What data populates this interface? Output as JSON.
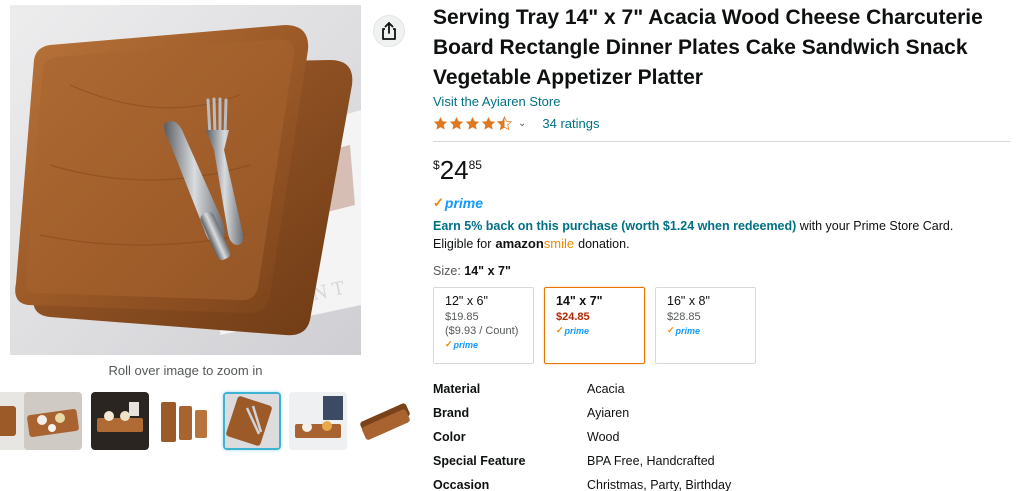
{
  "gallery": {
    "zoom_hint": "Roll over image to zoom in",
    "share_icon": "share-icon",
    "main_image_text": "PRINT",
    "thumbnails": [
      {
        "name": "thumb-tray-side"
      },
      {
        "name": "thumb-food-table"
      },
      {
        "name": "thumb-hand-dessert"
      },
      {
        "name": "thumb-three-trays"
      },
      {
        "name": "thumb-tray-utensils"
      },
      {
        "name": "thumb-hands-tray"
      },
      {
        "name": "thumb-stacked-trays"
      }
    ],
    "active_thumb_index": 4
  },
  "product": {
    "title": "Serving Tray 14\" x 7\" Acacia Wood Cheese Charcuterie Board Rectangle Dinner Plates Cake Sandwich Snack Vegetable Appetizer Platter",
    "store_link": "Visit the Ayiaren Store",
    "rating_value": 4.5,
    "ratings_count": "34 ratings",
    "price": {
      "symbol": "$",
      "whole": "24",
      "fraction": "85"
    },
    "prime_label": "prime",
    "earn_highlight": "Earn 5% back on this purchase (worth $1.24 when redeemed)",
    "earn_rest": " with your Prime Store Card.",
    "eligible_prefix": "Eligible for",
    "amazon_word": "amazon",
    "smile_word": "smile",
    "eligible_suffix": "donation.",
    "size_label": "Size:",
    "size_selected": "14\" x 7\"",
    "sizes": [
      {
        "name": "12\" x 6\"",
        "price": "$19.85",
        "unit": "($9.93 / Count)",
        "prime": "prime"
      },
      {
        "name": "14\" x 7\"",
        "price": "$24.85",
        "unit": "",
        "prime": "prime"
      },
      {
        "name": "16\" x 8\"",
        "price": "$28.85",
        "unit": "",
        "prime": "prime"
      }
    ],
    "specs": [
      {
        "key": "Material",
        "value": "Acacia"
      },
      {
        "key": "Brand",
        "value": "Ayiaren"
      },
      {
        "key": "Color",
        "value": "Wood"
      },
      {
        "key": "Special Feature",
        "value": "BPA Free, Handcrafted"
      },
      {
        "key": "Occasion",
        "value": "Christmas, Party, Birthday"
      }
    ]
  },
  "colors": {
    "link": "#007185",
    "star": "#de7921",
    "price_selected": "#b12704",
    "selected_border": "#e77600",
    "prime_blue": "#1399ff",
    "prime_check": "#f08804",
    "wood": "#a0612f"
  }
}
